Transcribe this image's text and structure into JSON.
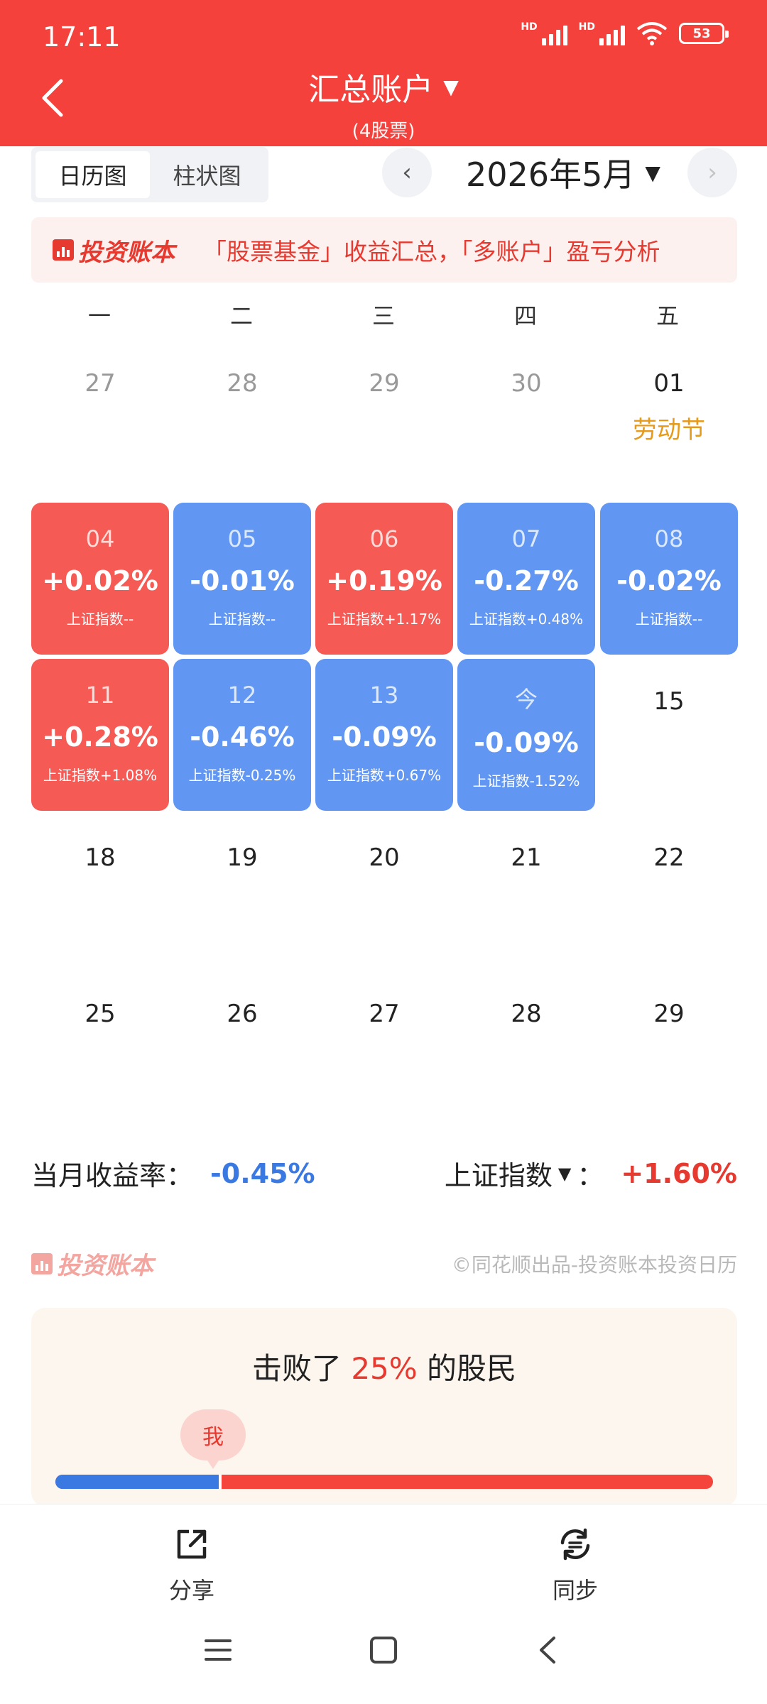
{
  "status": {
    "time": "17:11",
    "battery": "53",
    "hd": "HD"
  },
  "header": {
    "title": "汇总账户",
    "subtitle": "(4股票)",
    "caret": "▼"
  },
  "toolbar": {
    "tabs": [
      "日历图",
      "柱状图"
    ],
    "active_tab": "日历图",
    "month": "2026年5月",
    "prev": "‹",
    "next": "›"
  },
  "banner": {
    "logo_text": "投资账本",
    "text": "「股票基金」收益汇总，「多账户」盈亏分析"
  },
  "weekdays": [
    "一",
    "二",
    "三",
    "四",
    "五"
  ],
  "calendar": {
    "rows": [
      [
        {
          "day": "27",
          "kind": "muted"
        },
        {
          "day": "28",
          "kind": "muted"
        },
        {
          "day": "29",
          "kind": "muted"
        },
        {
          "day": "30",
          "kind": "muted"
        },
        {
          "day": "01",
          "kind": "plain",
          "holiday": "劳动节"
        }
      ],
      [
        {
          "day": "04",
          "kind": "up",
          "pct": "+0.02%",
          "idx": "上证指数--"
        },
        {
          "day": "05",
          "kind": "down",
          "pct": "-0.01%",
          "idx": "上证指数--"
        },
        {
          "day": "06",
          "kind": "up",
          "pct": "+0.19%",
          "idx": "上证指数+1.17%"
        },
        {
          "day": "07",
          "kind": "down",
          "pct": "-0.27%",
          "idx": "上证指数+0.48%"
        },
        {
          "day": "08",
          "kind": "down",
          "pct": "-0.02%",
          "idx": "上证指数--"
        }
      ],
      [
        {
          "day": "11",
          "kind": "up",
          "pct": "+0.28%",
          "idx": "上证指数+1.08%"
        },
        {
          "day": "12",
          "kind": "down",
          "pct": "-0.46%",
          "idx": "上证指数-0.25%"
        },
        {
          "day": "13",
          "kind": "down",
          "pct": "-0.09%",
          "idx": "上证指数+0.67%"
        },
        {
          "day": "今",
          "kind": "down",
          "pct": "-0.09%",
          "idx": "上证指数-1.52%"
        },
        {
          "day": "15",
          "kind": "plain"
        }
      ],
      [
        {
          "day": "18",
          "kind": "plain"
        },
        {
          "day": "19",
          "kind": "plain"
        },
        {
          "day": "20",
          "kind": "plain"
        },
        {
          "day": "21",
          "kind": "plain"
        },
        {
          "day": "22",
          "kind": "plain"
        }
      ],
      [
        {
          "day": "25",
          "kind": "plain"
        },
        {
          "day": "26",
          "kind": "plain"
        },
        {
          "day": "27",
          "kind": "plain"
        },
        {
          "day": "28",
          "kind": "plain"
        },
        {
          "day": "29",
          "kind": "plain"
        }
      ]
    ]
  },
  "summary": {
    "month_label": "当月收益率：",
    "month_value": "-0.45%",
    "index_label": "上证指数",
    "index_caret": "▼",
    "index_sep": "：",
    "index_value": "+1.60%"
  },
  "footer_brand": {
    "logo_text": "投资账本",
    "credit": "©同花顺出品-投资账本投资日历"
  },
  "beat": {
    "prefix": "击败了",
    "percent": "25%",
    "suffix": "的股民",
    "me": "我",
    "fraction": 0.25
  },
  "bottom": {
    "share": "分享",
    "sync": "同步"
  },
  "colors": {
    "header": "#f4413c",
    "up": "#f55a55",
    "down": "#6197f2",
    "holiday": "#e69a1c"
  }
}
